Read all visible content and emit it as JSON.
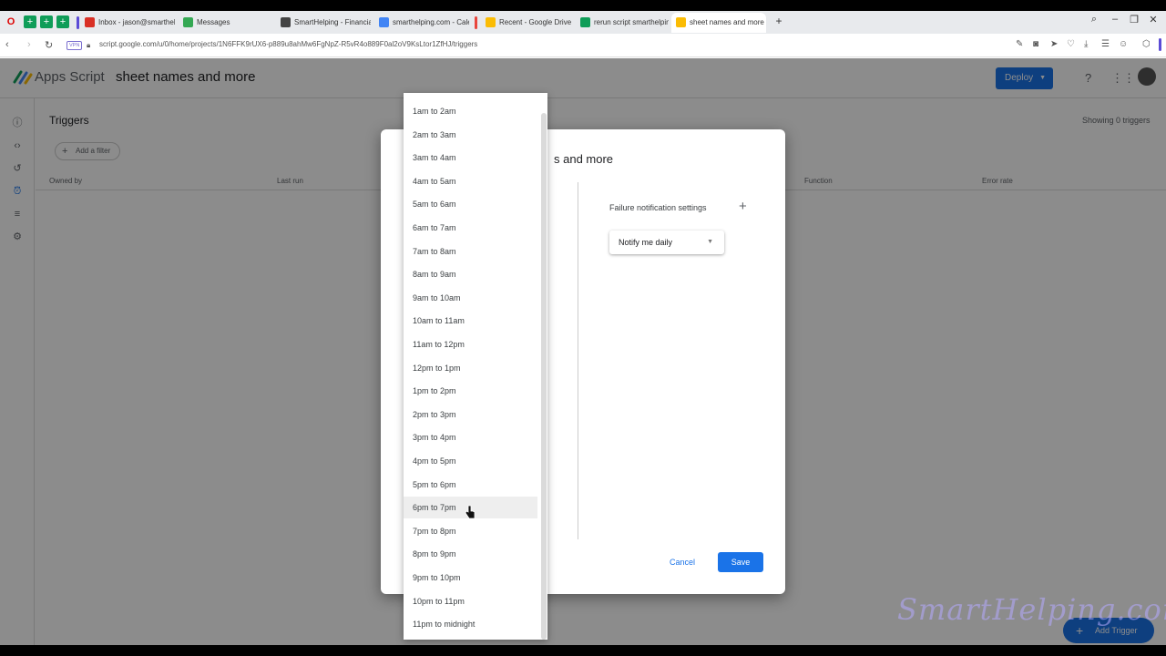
{
  "browser": {
    "tabs": [
      {
        "label": "Inbox - jason@smarthelp",
        "color": "#d93025"
      },
      {
        "label": "Messages",
        "color": "#34a853"
      },
      {
        "label": "SmartHelping - Financial",
        "color": "#444"
      },
      {
        "label": "smarthelping.com - Calen",
        "color": "#4285f4"
      },
      {
        "label": "Recent - Google Drive",
        "color": "#fbbc04"
      },
      {
        "label": "rerun script smarthelping",
        "color": "#0f9d58"
      },
      {
        "label": "sheet names and more -",
        "color": "#fbbc04"
      }
    ],
    "url": "script.google.com/u/0/home/projects/1N6FFK9rUX6-p889u8ahMw6FgNpZ-R5vR4o889F0al2oV9KsLtor1ZfHJ/triggers",
    "vpn_label": "VPN"
  },
  "app": {
    "name": "Apps Script",
    "project": "sheet names and more",
    "deploy_label": "Deploy",
    "page_title": "Triggers",
    "showing": "Showing 0 triggers",
    "add_filter": "Add a filter",
    "columns": [
      "Owned by",
      "Last run",
      "Function",
      "Error rate"
    ],
    "add_trigger": "Add Trigger"
  },
  "dialog": {
    "title_fragment": "s and more",
    "failure_label": "Failure notification settings",
    "notify_value": "Notify me daily",
    "cancel_label": "Cancel",
    "save_label": "Save"
  },
  "dropdown": {
    "options": [
      "1am to 2am",
      "2am to 3am",
      "3am to 4am",
      "4am to 5am",
      "5am to 6am",
      "6am to 7am",
      "7am to 8am",
      "8am to 9am",
      "9am to 10am",
      "10am to 11am",
      "11am to 12pm",
      "12pm to 1pm",
      "1pm to 2pm",
      "2pm to 3pm",
      "3pm to 4pm",
      "4pm to 5pm",
      "5pm to 6pm",
      "6pm to 7pm",
      "7pm to 8pm",
      "8pm to 9pm",
      "9pm to 10pm",
      "10pm to 11pm",
      "11pm to midnight"
    ],
    "hovered": "6pm to 7pm"
  },
  "watermark": "SmartHelping.com",
  "colors": {
    "accent": "#1a73e8"
  }
}
